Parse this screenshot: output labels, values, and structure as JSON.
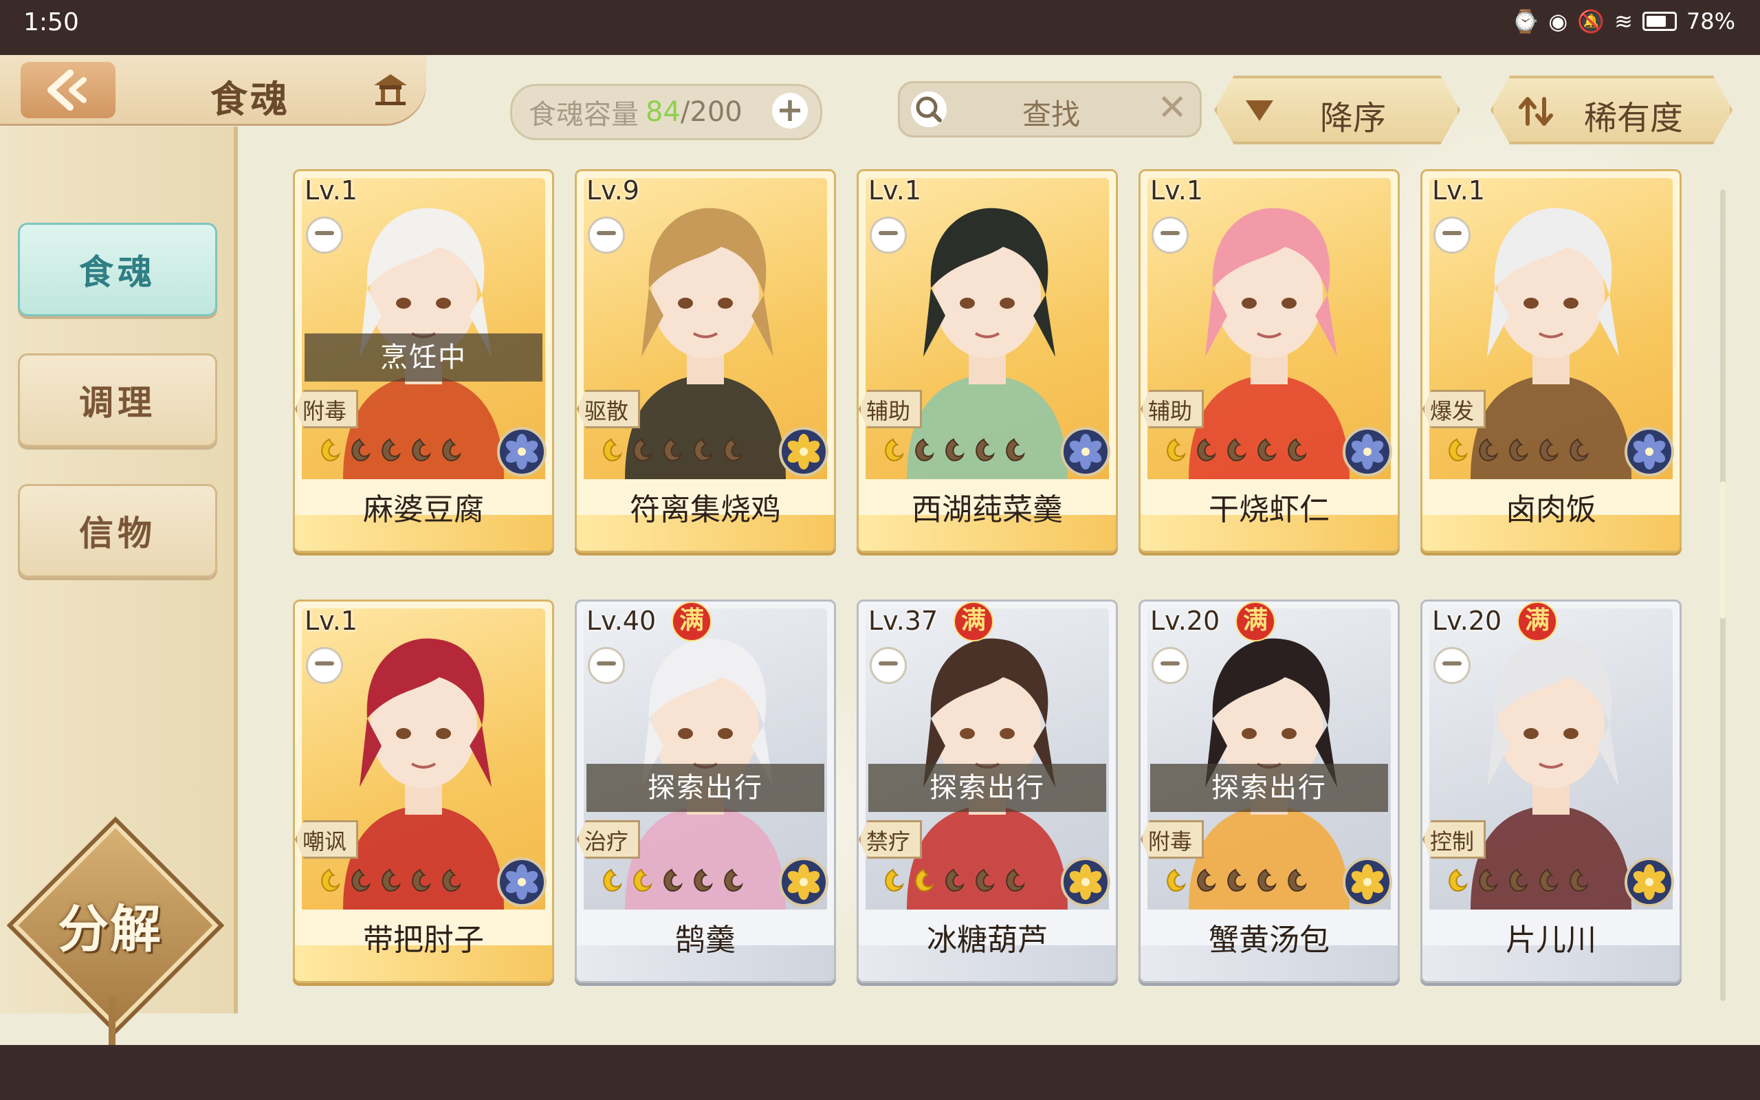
{
  "status_bar": {
    "time": "1:50",
    "battery": "78%"
  },
  "header": {
    "title": "食魂",
    "capacity_label": "食魂容量",
    "capacity_current": "84",
    "capacity_sep": "/",
    "capacity_max": "200",
    "search_placeholder": "查找",
    "sort_order_label": "降序",
    "sort_field_label": "稀有度"
  },
  "sidebar": {
    "tabs": [
      {
        "label": "食魂",
        "active": true
      },
      {
        "label": "调理",
        "active": false
      },
      {
        "label": "信物",
        "active": false
      }
    ],
    "decompose_label": "分解"
  },
  "cards": [
    {
      "level": "Lv.1",
      "name": "麻婆豆腐",
      "role": "附毒",
      "status": "烹饪中",
      "full": "",
      "tier": "gold",
      "stars": 1,
      "element": "blue",
      "hair": "#f3f1ee",
      "accent": "#d24a23"
    },
    {
      "level": "Lv.9",
      "name": "符离集烧鸡",
      "role": "驱散",
      "status": "",
      "full": "",
      "tier": "gold",
      "stars": 1,
      "element": "gold",
      "hair": "#c79a5a",
      "accent": "#2b2b2b"
    },
    {
      "level": "Lv.1",
      "name": "西湖莼菜羹",
      "role": "辅助",
      "status": "",
      "full": "",
      "tier": "gold",
      "stars": 1,
      "element": "blue",
      "hair": "#2b2f2a",
      "accent": "#8fc7a8"
    },
    {
      "level": "Lv.1",
      "name": "干烧虾仁",
      "role": "辅助",
      "status": "",
      "full": "",
      "tier": "gold",
      "stars": 1,
      "element": "blue",
      "hair": "#f29aa7",
      "accent": "#e2402e"
    },
    {
      "level": "Lv.1",
      "name": "卤肉饭",
      "role": "爆发",
      "status": "",
      "full": "",
      "tier": "gold",
      "stars": 1,
      "element": "blue",
      "hair": "#eeeeee",
      "accent": "#7b5433"
    },
    {
      "level": "Lv.1",
      "name": "带把肘子",
      "role": "嘲讽",
      "status": "",
      "full": "",
      "tier": "gold",
      "stars": 1,
      "element": "blue",
      "hair": "#b5283a",
      "accent": "#c92a2a"
    },
    {
      "level": "Lv.40",
      "name": "鹄羹",
      "role": "治疗",
      "status": "探索出行",
      "full": "满",
      "tier": "silver",
      "stars": 2,
      "element": "gold",
      "hair": "#f0f0f3",
      "accent": "#e8a9c4"
    },
    {
      "level": "Lv.37",
      "name": "冰糖葫芦",
      "role": "禁疗",
      "status": "探索出行",
      "full": "满",
      "tier": "silver",
      "stars": 2,
      "element": "gold",
      "hair": "#4a3228",
      "accent": "#c9302c"
    },
    {
      "level": "Lv.20",
      "name": "蟹黄汤包",
      "role": "附毒",
      "status": "探索出行",
      "full": "满",
      "tier": "silver",
      "stars": 1,
      "element": "gold",
      "hair": "#2a2020",
      "accent": "#f5a93b"
    },
    {
      "level": "Lv.20",
      "name": "片儿川",
      "role": "控制",
      "status": "",
      "full": "满",
      "tier": "silver",
      "stars": 1,
      "element": "gold",
      "hair": "#e6e6e9",
      "accent": "#6b2a2a"
    }
  ]
}
